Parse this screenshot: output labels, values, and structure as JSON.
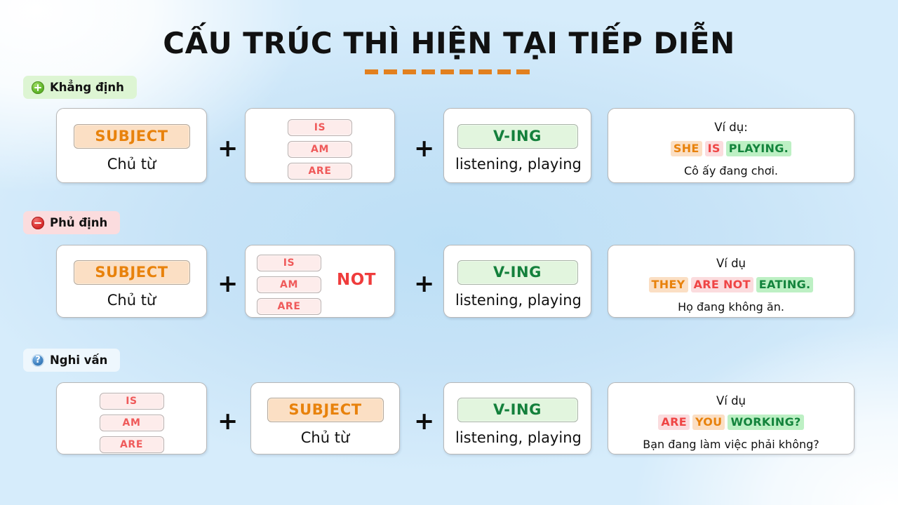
{
  "title": {
    "text": "CẤU TRÚC THÌ HIỆN TẠI TIẾP DIỄN"
  },
  "sections": [
    {
      "id": "affirmative",
      "label": "Khẳng định",
      "icon": "plus-circle-icon",
      "pill_color": "#ddf5d3",
      "subject": {
        "chip": "SUBJECT",
        "label": "Chủ từ"
      },
      "be": {
        "options": [
          "IS",
          "AM",
          "ARE"
        ],
        "extra": ""
      },
      "verb": {
        "chip": "V-ING",
        "label": "listening, playing"
      },
      "operator_1": "+",
      "operator_2": "+",
      "example": {
        "heading": "Ví dụ:",
        "parts": [
          {
            "text": "SHE",
            "style": "subject"
          },
          {
            "text": "IS",
            "style": "be"
          },
          {
            "text": "PLAYING.",
            "style": "verb"
          }
        ],
        "translation": "Cô ấy đang chơi."
      }
    },
    {
      "id": "negative",
      "label": "Phủ định",
      "icon": "minus-circle-icon",
      "pill_color": "#fbdcde",
      "subject": {
        "chip": "SUBJECT",
        "label": "Chủ từ"
      },
      "be": {
        "options": [
          "IS",
          "AM",
          "ARE"
        ],
        "extra": "NOT"
      },
      "verb": {
        "chip": "V-ING",
        "label": "listening, playing"
      },
      "operator_1": "+",
      "operator_2": "+",
      "example": {
        "heading": "Ví dụ",
        "parts": [
          {
            "text": "THEY",
            "style": "subject"
          },
          {
            "text": "ARE NOT",
            "style": "be"
          },
          {
            "text": "EATING.",
            "style": "verb"
          }
        ],
        "translation": "Họ đang không ăn."
      }
    },
    {
      "id": "question",
      "label": "Nghi vấn",
      "icon": "question-circle-icon",
      "pill_color": "#eef7fd",
      "subject": {
        "chip": "SUBJECT",
        "label": "Chủ từ"
      },
      "be": {
        "options": [
          "IS",
          "AM",
          "ARE"
        ],
        "extra": ""
      },
      "verb": {
        "chip": "V-ING",
        "label": "listening, playing"
      },
      "operator_1": "+",
      "operator_2": "+",
      "example": {
        "heading": "Ví dụ",
        "parts": [
          {
            "text": "ARE",
            "style": "be"
          },
          {
            "text": "YOU",
            "style": "subject"
          },
          {
            "text": "WORKING?",
            "style": "verb"
          }
        ],
        "translation": "Bạn đang làm việc phải không?"
      }
    }
  ],
  "colors": {
    "subject_text": "#e8820c",
    "subject_bg": "#fbdfc4",
    "be_text": "#ef5a5a",
    "be_bg": "#fdeceb",
    "verb_text": "#14803c",
    "verb_bg": "#e2f5de",
    "not_text": "#ef3c3c",
    "title_underline": "#e2801f",
    "page_bg": "#c7e3f7"
  }
}
